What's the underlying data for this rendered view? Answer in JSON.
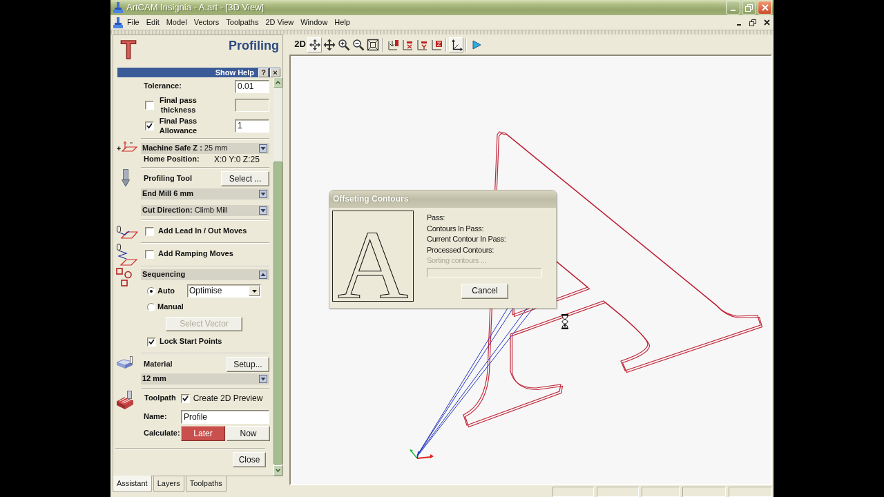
{
  "window": {
    "title": "ArtCAM Insignia - A.art - [3D View]"
  },
  "menu": [
    "File",
    "Edit",
    "Model",
    "Vectors",
    "Toolpaths",
    "2D View",
    "Window",
    "Help"
  ],
  "assistant": {
    "logo": "T",
    "title": "Profiling",
    "help_bar": {
      "label": "Show Help",
      "buttons": [
        "?",
        "×"
      ]
    },
    "tolerance": {
      "label": "Tolerance:",
      "value": "0.01"
    },
    "final_pass": [
      {
        "label": "Final pass thickness",
        "checked": false
      },
      {
        "label": "Final Pass Allowance",
        "checked": true,
        "value": "1"
      }
    ],
    "safe_z": {
      "section": {
        "label": "Machine Safe Z :",
        "value": "25 mm",
        "expanded": false
      },
      "home_label": "Home Position:",
      "home_value": "X:0 Y:0 Z:25"
    },
    "tool": {
      "label": "Profiling Tool",
      "button": "Select ...",
      "sections": [
        {
          "label": "End Mill 6 mm",
          "expanded": false
        },
        {
          "label": "Cut Direction:",
          "value": "Climb Mill",
          "expanded": false
        }
      ]
    },
    "moves": [
      {
        "label": "Add Lead In / Out Moves",
        "checked": false
      },
      {
        "label": "Add Ramping Moves",
        "checked": false
      }
    ],
    "sequencing": {
      "section": {
        "label": "Sequencing",
        "expanded": true
      },
      "modes": [
        {
          "label": "Auto",
          "selected": true
        },
        {
          "label": "Manual",
          "selected": false
        }
      ],
      "method": "Optimise",
      "select_button": {
        "label": "Select Vector",
        "disabled": true
      },
      "lock_start": {
        "label": "Lock Start Points",
        "checked": true
      }
    },
    "material": {
      "label": "Material",
      "button": "Setup...",
      "section": {
        "label": "12 mm",
        "expanded": false
      }
    },
    "toolpath": {
      "label": "Toolpath",
      "preview": {
        "label": "Create 2D Preview",
        "checked": true
      },
      "name_label": "Name:",
      "name": "Profile",
      "calculate_label": "Calculate:",
      "calculate": [
        {
          "label": "Later",
          "selected": true
        },
        {
          "label": "Now",
          "selected": false
        }
      ]
    },
    "close": "Close"
  },
  "panel_tabs": [
    {
      "label": "Assistant",
      "selected": true
    },
    {
      "label": "Layers",
      "selected": false
    },
    {
      "label": "Toolpaths",
      "selected": false
    }
  ],
  "toolbar": [
    {
      "kind": "text",
      "label": "2D",
      "selected": false
    },
    {
      "kind": "icon",
      "selected": true
    },
    {
      "kind": "icon",
      "selected": false
    },
    {
      "kind": "icon",
      "selected": false
    },
    {
      "kind": "icon",
      "selected": false
    },
    {
      "kind": "icon",
      "selected": false
    },
    {
      "kind": "separator"
    },
    {
      "kind": "icon",
      "selected": false
    },
    {
      "kind": "icon",
      "selected": false
    },
    {
      "kind": "icon",
      "selected": false
    },
    {
      "kind": "icon",
      "selected": false
    },
    {
      "kind": "separator"
    },
    {
      "kind": "icon",
      "selected": true
    },
    {
      "kind": "separator"
    },
    {
      "kind": "icon",
      "selected": false
    }
  ],
  "dialog": {
    "title": "Offseting Contours",
    "preview": "A",
    "fields": [
      "Pass:",
      "Contours In Pass:",
      "Current Contour In Pass:",
      "Processed Contours:"
    ],
    "status": {
      "label": "Sorting contours ...",
      "disabled": true
    },
    "progress": {
      "level": 0
    },
    "cancel": "Cancel"
  }
}
